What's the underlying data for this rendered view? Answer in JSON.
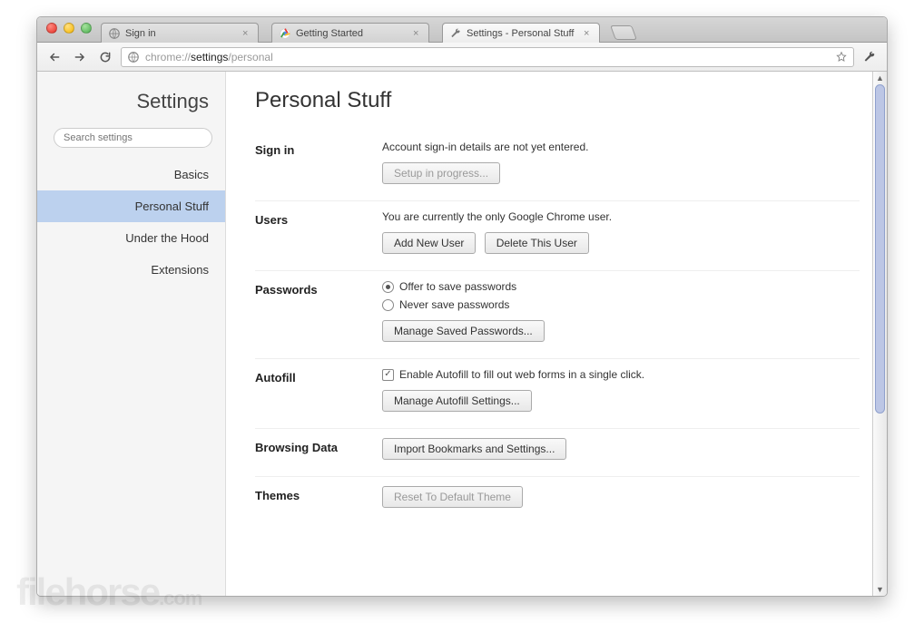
{
  "tabs": [
    {
      "label": "Sign in",
      "icon": "globe"
    },
    {
      "label": "Getting Started",
      "icon": "chrome"
    },
    {
      "label": "Settings - Personal Stuff",
      "icon": "wrench"
    }
  ],
  "active_tab": 2,
  "url": {
    "scheme": "chrome://",
    "path1": "settings",
    "path2": "/personal"
  },
  "sidebar": {
    "title": "Settings",
    "search_placeholder": "Search settings",
    "items": [
      "Basics",
      "Personal Stuff",
      "Under the Hood",
      "Extensions"
    ],
    "active_index": 1
  },
  "page": {
    "title": "Personal Stuff",
    "signin": {
      "label": "Sign in",
      "desc": "Account sign-in details are not yet entered.",
      "button": "Setup in progress..."
    },
    "users": {
      "label": "Users",
      "desc": "You are currently the only Google Chrome user.",
      "add_btn": "Add New User",
      "delete_btn": "Delete This User"
    },
    "passwords": {
      "label": "Passwords",
      "opt_offer": "Offer to save passwords",
      "opt_never": "Never save passwords",
      "manage_btn": "Manage Saved Passwords..."
    },
    "autofill": {
      "label": "Autofill",
      "check_label": "Enable Autofill to fill out web forms in a single click.",
      "manage_btn": "Manage Autofill Settings..."
    },
    "browsing": {
      "label": "Browsing Data",
      "import_btn": "Import Bookmarks and Settings..."
    },
    "themes": {
      "label": "Themes",
      "reset_btn": "Reset To Default Theme"
    }
  },
  "watermark": {
    "brand": "filehorse",
    "tld": ".com"
  }
}
